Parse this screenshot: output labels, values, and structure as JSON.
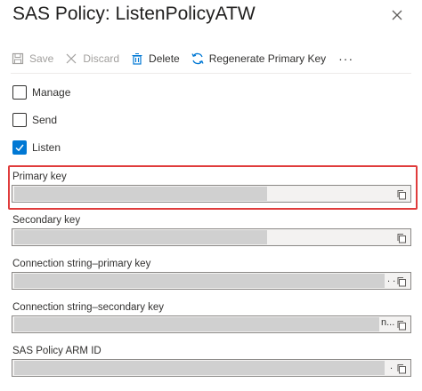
{
  "panel": {
    "title": "SAS Policy: ListenPolicyATW"
  },
  "toolbar": {
    "save": "Save",
    "discard": "Discard",
    "delete": "Delete",
    "regenerate": "Regenerate Primary Key",
    "more": "···"
  },
  "claims": [
    {
      "label": "Manage",
      "checked": false
    },
    {
      "label": "Send",
      "checked": false
    },
    {
      "label": "Listen",
      "checked": true
    }
  ],
  "fields": {
    "primary_key": {
      "label": "Primary key",
      "value": ""
    },
    "secondary_key": {
      "label": "Secondary key",
      "value": ""
    },
    "conn_primary": {
      "label": "Connection string–primary key",
      "value": "",
      "trail": ". ."
    },
    "conn_secondary": {
      "label": "Connection string–secondary key",
      "value": "",
      "trail": "n..."
    },
    "arm_id": {
      "label": "SAS Policy ARM ID",
      "value": "",
      "trail": "."
    }
  },
  "colors": {
    "accent": "#0078d4",
    "highlight": "#e03c3c"
  }
}
